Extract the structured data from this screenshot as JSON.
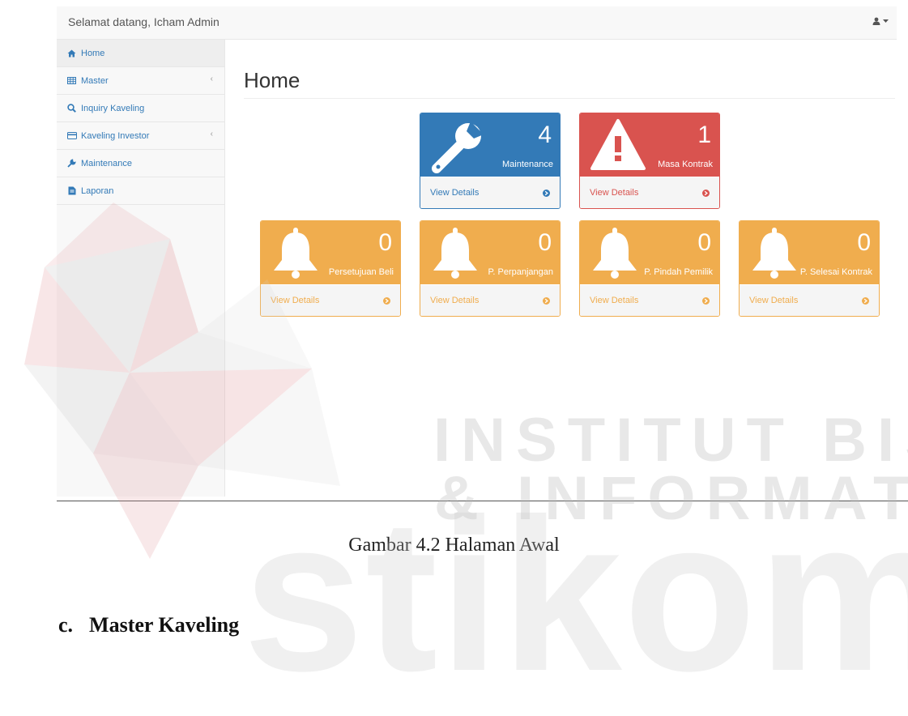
{
  "topbar": {
    "welcome": "Selamat datang, Icham Admin",
    "user_icon": "user-icon",
    "caret_icon": "caret-down-icon"
  },
  "sidebar": {
    "items": [
      {
        "label": "Home",
        "icon": "home-icon",
        "active": true,
        "submenu": false
      },
      {
        "label": "Master",
        "icon": "table-icon",
        "active": false,
        "submenu": true
      },
      {
        "label": "Inquiry Kaveling",
        "icon": "search-icon",
        "active": false,
        "submenu": false
      },
      {
        "label": "Kaveling Investor",
        "icon": "credit-card-icon",
        "active": false,
        "submenu": true
      },
      {
        "label": "Maintenance",
        "icon": "wrench-icon",
        "active": false,
        "submenu": false
      },
      {
        "label": "Laporan",
        "icon": "file-icon",
        "active": false,
        "submenu": false
      }
    ],
    "submenu_icon": "chevron-left-icon"
  },
  "main": {
    "title": "Home",
    "panels": [
      {
        "count": "4",
        "label": "Maintenance",
        "footer": "View Details",
        "color": "#337ab7",
        "icon": "wrench-icon"
      },
      {
        "count": "1",
        "label": "Masa Kontrak",
        "footer": "View Details",
        "color": "#d9534f",
        "icon": "warning-icon"
      },
      {
        "count": "0",
        "label": "Persetujuan Beli",
        "footer": "View Details",
        "color": "#f0ad4e",
        "icon": "bell-icon"
      },
      {
        "count": "0",
        "label": "P. Perpanjangan",
        "footer": "View Details",
        "color": "#f0ad4e",
        "icon": "bell-icon"
      },
      {
        "count": "0",
        "label": "P. Pindah Pemilik",
        "footer": "View Details",
        "color": "#f0ad4e",
        "icon": "bell-icon"
      },
      {
        "count": "0",
        "label": "P. Selesai Kontrak",
        "footer": "View Details",
        "color": "#f0ad4e",
        "icon": "bell-icon"
      }
    ]
  },
  "document": {
    "caption": "Gambar 4.2 Halaman Awal",
    "subsection_marker": "c.",
    "subsection_title": "Master Kaveling"
  },
  "watermark": {
    "line1": "INSTITUT BISNIS",
    "line2": "& INFORMATIKA",
    "line3": "stikom"
  }
}
